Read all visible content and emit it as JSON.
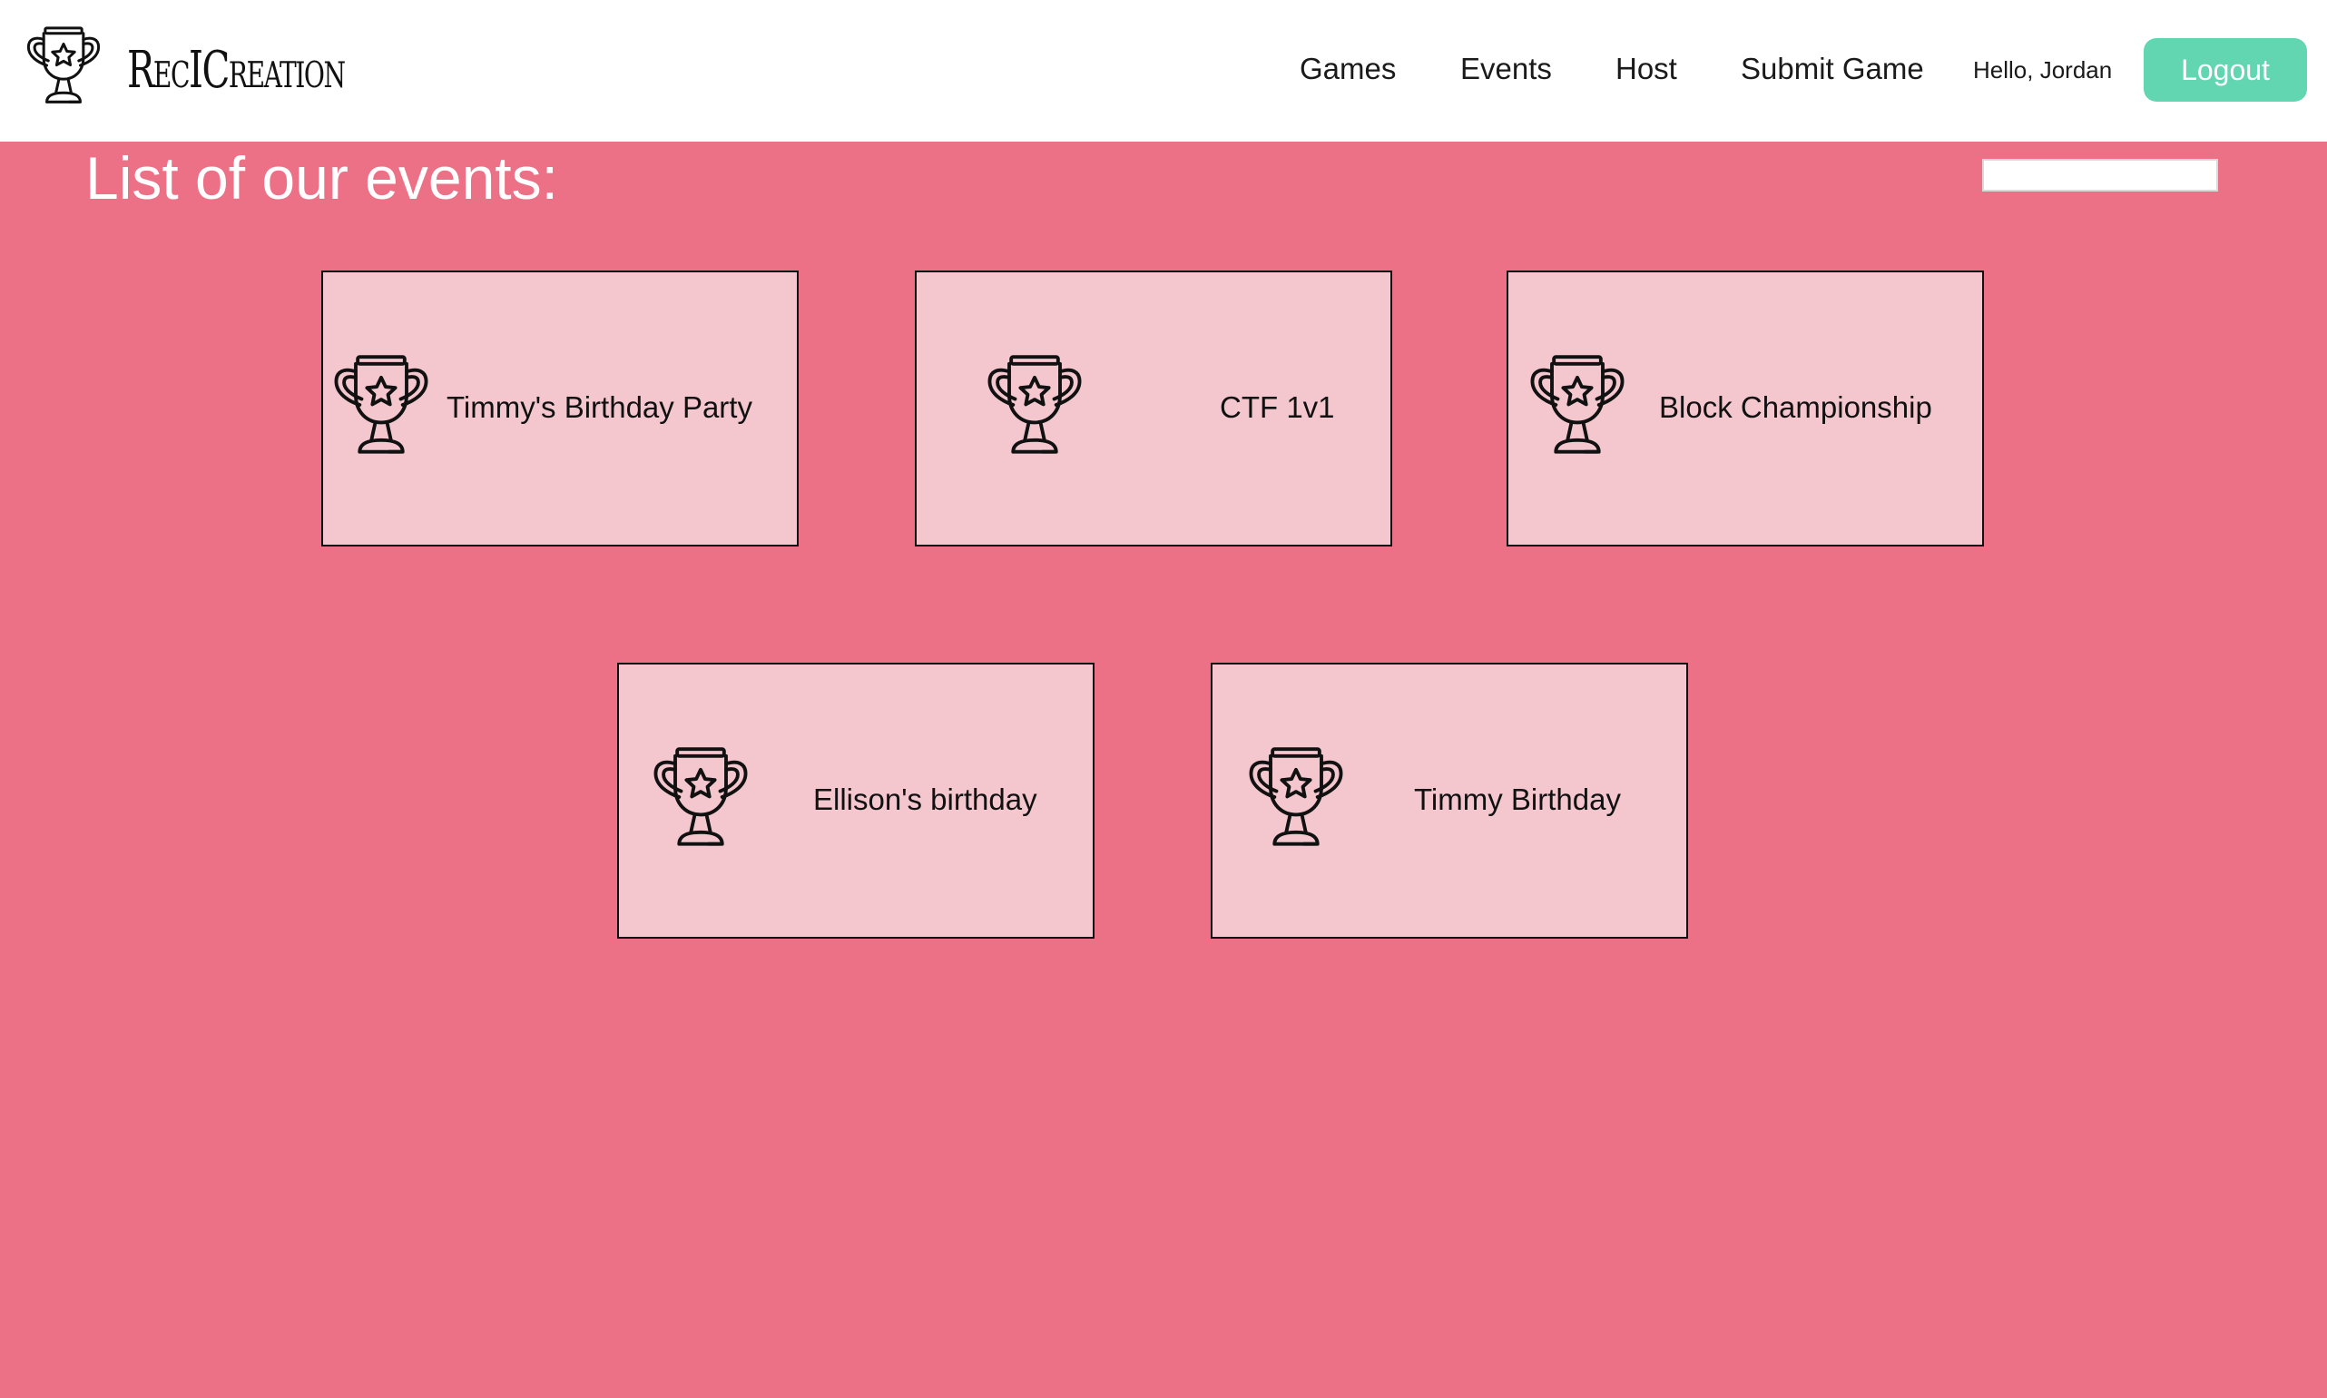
{
  "brand": {
    "name": "RecICreation",
    "logo_icon": "trophy-icon"
  },
  "nav": {
    "games": "Games",
    "events": "Events",
    "host": "Host",
    "submit_game": "Submit Game"
  },
  "user": {
    "greeting": "Hello, Jordan",
    "logout_label": "Logout"
  },
  "page": {
    "title": "List of our events:",
    "search_value": ""
  },
  "events": [
    {
      "name": "Timmy's Birthday Party",
      "icon": "trophy-icon"
    },
    {
      "name": "CTF 1v1",
      "icon": "trophy-icon"
    },
    {
      "name": "Block Championship",
      "icon": "trophy-icon"
    },
    {
      "name": "Ellison's birthday",
      "icon": "trophy-icon"
    },
    {
      "name": "Timmy Birthday",
      "icon": "trophy-icon"
    }
  ],
  "colors": {
    "page_background": "#ec7186",
    "header_background": "#ffffff",
    "card_background": "#f4c7cf",
    "logout_button": "#62d6b1",
    "title_text": "#ffffff"
  }
}
